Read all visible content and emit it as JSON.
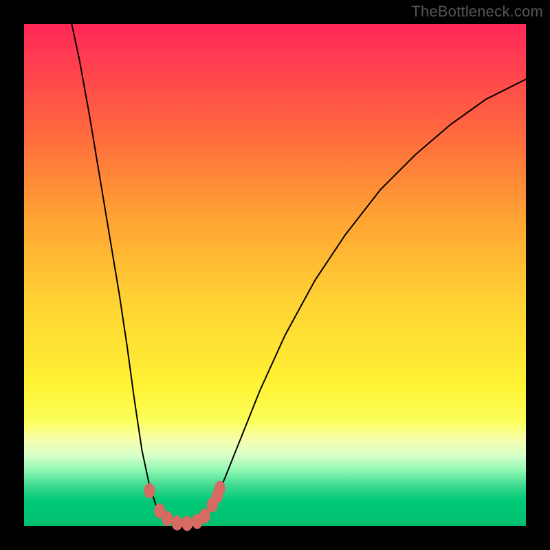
{
  "watermark": "TheBottleneck.com",
  "colors": {
    "background": "#000000",
    "gradient_top": "#ff2857",
    "gradient_mid": "#fff233",
    "gradient_bottom": "#00c070",
    "curve": "#000000",
    "markers": "#d66b63"
  },
  "chart_data": {
    "type": "line",
    "title": "",
    "xlabel": "",
    "ylabel": "",
    "xlim": [
      0,
      100
    ],
    "ylim": [
      0,
      100
    ],
    "grid": false,
    "curve_points": [
      {
        "x": 9.5,
        "y": 100.0
      },
      {
        "x": 11.0,
        "y": 93.0
      },
      {
        "x": 13.0,
        "y": 82.0
      },
      {
        "x": 15.0,
        "y": 70.0
      },
      {
        "x": 17.0,
        "y": 58.0
      },
      {
        "x": 19.0,
        "y": 46.0
      },
      {
        "x": 20.5,
        "y": 36.0
      },
      {
        "x": 22.0,
        "y": 25.0
      },
      {
        "x": 23.5,
        "y": 15.0
      },
      {
        "x": 25.0,
        "y": 8.0
      },
      {
        "x": 26.5,
        "y": 3.5
      },
      {
        "x": 28.0,
        "y": 1.5
      },
      {
        "x": 30.0,
        "y": 0.5
      },
      {
        "x": 32.0,
        "y": 0.3
      },
      {
        "x": 34.0,
        "y": 0.8
      },
      {
        "x": 36.0,
        "y": 2.0
      },
      {
        "x": 38.0,
        "y": 5.0
      },
      {
        "x": 40.0,
        "y": 9.5
      },
      {
        "x": 43.0,
        "y": 17.0
      },
      {
        "x": 47.0,
        "y": 27.0
      },
      {
        "x": 52.0,
        "y": 38.0
      },
      {
        "x": 58.0,
        "y": 49.0
      },
      {
        "x": 64.0,
        "y": 58.0
      },
      {
        "x": 71.0,
        "y": 67.0
      },
      {
        "x": 78.0,
        "y": 74.0
      },
      {
        "x": 85.0,
        "y": 80.0
      },
      {
        "x": 92.0,
        "y": 85.0
      },
      {
        "x": 100.0,
        "y": 89.0
      }
    ],
    "markers": [
      {
        "x": 25.0,
        "y": 7.0
      },
      {
        "x": 27.0,
        "y": 3.0
      },
      {
        "x": 28.5,
        "y": 1.5
      },
      {
        "x": 30.5,
        "y": 0.6
      },
      {
        "x": 32.5,
        "y": 0.5
      },
      {
        "x": 34.5,
        "y": 0.9
      },
      {
        "x": 36.0,
        "y": 2.0
      },
      {
        "x": 37.5,
        "y": 4.2
      },
      {
        "x": 38.5,
        "y": 6.0
      },
      {
        "x": 39.0,
        "y": 7.5
      }
    ]
  }
}
